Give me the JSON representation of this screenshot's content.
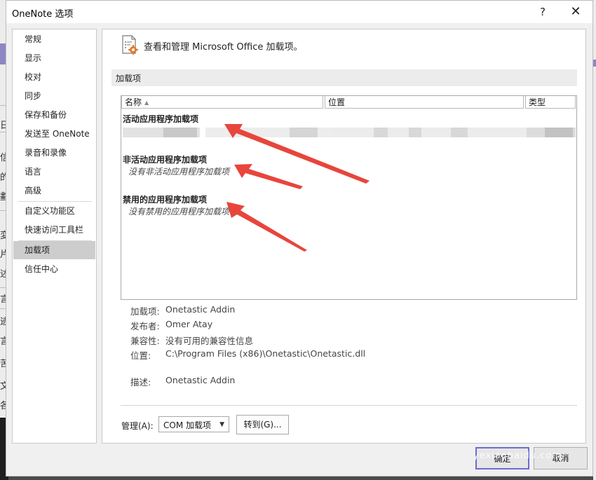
{
  "window": {
    "title": "OneNote 选项",
    "help_glyph": "?",
    "close_glyph": "✕"
  },
  "background": {
    "chars": [
      "日",
      "信",
      "的",
      "劃",
      "変",
      "片",
      "述",
      "言",
      "迹",
      "言",
      "苦",
      "文",
      "各"
    ]
  },
  "sidebar": {
    "items": [
      {
        "label": "常规"
      },
      {
        "label": "显示"
      },
      {
        "label": "校对"
      },
      {
        "label": "同步"
      },
      {
        "label": "保存和备份"
      },
      {
        "label": "发送至 OneNote"
      },
      {
        "label": "录音和录像"
      },
      {
        "label": "语言"
      },
      {
        "label": "高级"
      },
      {
        "label": "自定义功能区"
      },
      {
        "label": "快速访问工具栏"
      },
      {
        "label": "加载项"
      },
      {
        "label": "信任中心"
      }
    ],
    "selected": "加载项"
  },
  "main": {
    "header_text": "查看和管理 Microsoft Office 加载项。",
    "section_title": "加载项",
    "columns": {
      "name": "名称",
      "location": "位置",
      "type": "类型"
    },
    "groups": {
      "active_title": "活动应用程序加载项",
      "inactive_title": "非活动应用程序加载项",
      "inactive_empty": "没有非活动应用程序加载项",
      "disabled_title": "禁用的应用程序加载项",
      "disabled_empty": "没有禁用的应用程序加载项"
    },
    "details": {
      "addin_label": "加载项:",
      "addin_value": "Onetastic Addin",
      "publisher_label": "发布者:",
      "publisher_value": "Omer Atay",
      "compat_label": "兼容性:",
      "compat_value": "没有可用的兼容性信息",
      "location_label": "位置:",
      "location_value": "C:\\Program Files (x86)\\Onetastic\\Onetastic.dll",
      "desc_label": "描述:",
      "desc_value": "Onetastic Addin"
    },
    "manage": {
      "label": "管理(A):",
      "selected_option": "COM 加载项",
      "go_button": "转到(G)..."
    }
  },
  "footer": {
    "ok": "确定",
    "cancel": "取消",
    "watermark": "yexiaobaidu.com"
  },
  "colors": {
    "arrow": "#e8453c",
    "selected_item": "#cdcdcd",
    "ok_focus": "#6b6bd1"
  }
}
